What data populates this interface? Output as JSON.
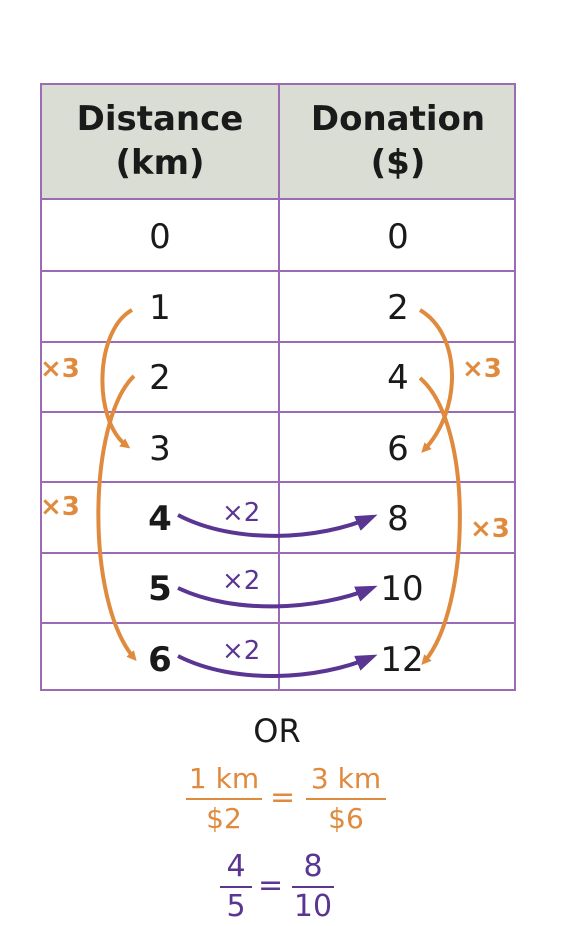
{
  "table": {
    "headers": [
      {
        "line1": "Distance",
        "line2": "(km)"
      },
      {
        "line1": "Donation",
        "line2": "($)"
      }
    ],
    "rows": [
      {
        "distance": "0",
        "donation": "0"
      },
      {
        "distance": "1",
        "donation": "2"
      },
      {
        "distance": "2",
        "donation": "4"
      },
      {
        "distance": "3",
        "donation": "6"
      },
      {
        "distance": "4",
        "donation": "8"
      },
      {
        "distance": "5",
        "donation": "10"
      },
      {
        "distance": "6",
        "donation": "12"
      }
    ]
  },
  "annotations": {
    "left_times3_a": "×3",
    "left_times3_b": "×3",
    "right_times3_a": "×3",
    "right_times3_b": "×3",
    "times2_row4": "×2",
    "times2_row5": "×2",
    "times2_row6": "×2"
  },
  "or_label": "OR",
  "ratio1": {
    "left_num": "1 km",
    "left_den": "$2",
    "eq": "=",
    "right_num": "3 km",
    "right_den": "$6"
  },
  "ratio2": {
    "left_num": "4",
    "left_den": "5",
    "eq": "=",
    "right_num": "8",
    "right_den": "10"
  },
  "colors": {
    "orange": "#e08a3e",
    "purple": "#5a3591",
    "border": "#9b6bb5",
    "header_bg": "#d9ddd3"
  }
}
